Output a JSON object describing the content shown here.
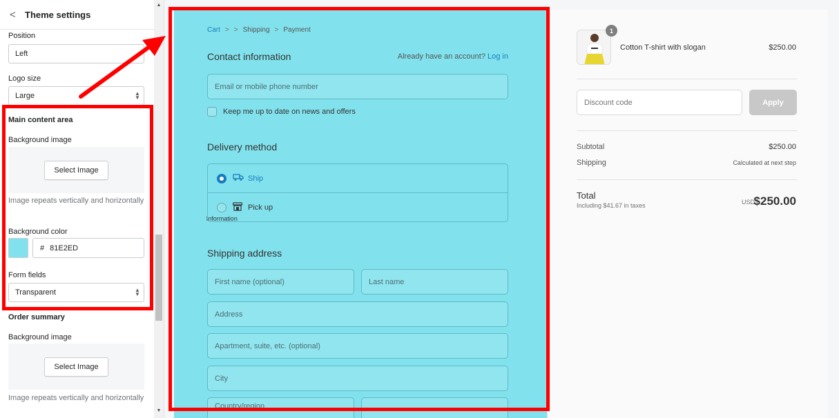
{
  "sidebar": {
    "header": {
      "back_glyph": "<",
      "title": "Theme settings"
    },
    "position": {
      "label": "Position",
      "value": "Left"
    },
    "logo_size": {
      "label": "Logo size",
      "value": "Large"
    },
    "main_content": {
      "heading": "Main content area",
      "bg_image_label": "Background image",
      "select_image": "Select Image",
      "help": "Image repeats vertically and horizontally",
      "bg_color_label": "Background color",
      "color_hash": "#",
      "color_value": "81E2ED",
      "form_fields_label": "Form fields",
      "form_fields_value": "Transparent"
    },
    "order_summary": {
      "heading": "Order summary",
      "bg_image_label": "Background image",
      "select_image": "Select Image",
      "help": "Image repeats vertically and horizontally"
    }
  },
  "checkout": {
    "breadcrumbs": [
      "Cart",
      "Information",
      "Shipping",
      "Payment"
    ],
    "breadcrumb_sep": ">",
    "contact": {
      "title": "Contact information",
      "account_text": "Already have an account?",
      "login_link": "Log in",
      "email_placeholder": "Email or mobile phone number",
      "newsletter_label": "Keep me up to date on news and offers"
    },
    "delivery": {
      "title": "Delivery method",
      "options": [
        {
          "label": "Ship",
          "icon": "truck-icon",
          "selected": true
        },
        {
          "label": "Pick up",
          "icon": "store-icon",
          "selected": false
        }
      ]
    },
    "shipping": {
      "title": "Shipping address",
      "first_name": "First name (optional)",
      "last_name": "Last name",
      "address": "Address",
      "apartment": "Apartment, suite, etc. (optional)",
      "city": "City",
      "country": "Country/region"
    }
  },
  "summary": {
    "product": {
      "name": "Cotton T-shirt with slogan",
      "price": "$250.00",
      "quantity": "1"
    },
    "discount_placeholder": "Discount code",
    "apply_label": "Apply",
    "subtotal_label": "Subtotal",
    "subtotal_value": "$250.00",
    "shipping_label": "Shipping",
    "shipping_value": "Calculated at next step",
    "total_label": "Total",
    "tax_note": "Including $41.67 in taxes",
    "currency": "USD",
    "total_value": "$250.00"
  },
  "colors": {
    "main_background": "#81E2ED",
    "link": "#197bbd",
    "annotation": "#ff0000"
  }
}
